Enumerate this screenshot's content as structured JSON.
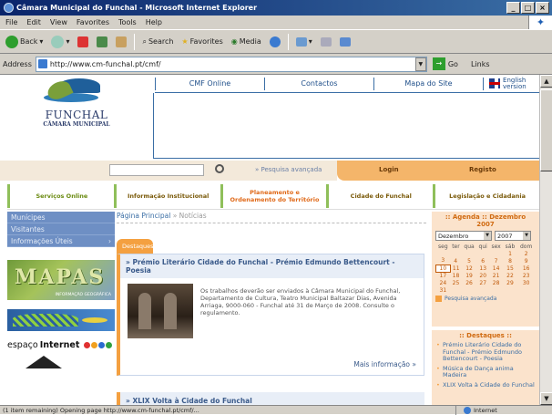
{
  "window": {
    "title": "Câmara Municipal do Funchal - Microsoft Internet Explorer",
    "controls": [
      "_",
      "□",
      "×"
    ]
  },
  "menu": [
    "File",
    "Edit",
    "View",
    "Favorites",
    "Tools",
    "Help"
  ],
  "toolbar": {
    "back": "Back",
    "search": "Search",
    "favorites": "Favorites",
    "media": "Media"
  },
  "address": {
    "label": "Address",
    "url": "http://www.cm-funchal.pt/cmf/",
    "go": "Go",
    "links": "Links"
  },
  "site": {
    "logo": {
      "name": "FUNCHAL",
      "sub": "CÂMARA MUNICIPAL"
    },
    "topnav": [
      "CMF Online",
      "Contactos",
      "Mapa do Site"
    ],
    "english": "English version",
    "search": {
      "advanced": "» Pesquisa avançada"
    },
    "login": "Login",
    "register": "Registo",
    "mainmenu": [
      "Serviços Online",
      "Informação Institucional",
      "Planeamento e Ordenamento do Território",
      "Cidade do Funchal",
      "Legislação e Cidadania"
    ],
    "leftnav": [
      "Munícipes",
      "Visitantes",
      "Informações Úteis"
    ],
    "mapas": "MAPAS",
    "mapas_sub": "INFORMAÇÃO GEOGRÁFICA",
    "espaco": {
      "a": "espaço",
      "b": "Internet"
    },
    "breadcrumb": {
      "home": "Página Principal",
      "current": " » Notícias"
    },
    "destaques_tab": "Destaques",
    "news1": {
      "title": "» Prémio Literário Cidade do Funchal - Prémio Edmundo Bettencourt - Poesia",
      "body": "Os trabalhos deverão ser enviados à Câmara Municipal do Funchal, Departamento de Cultura, Teatro Municipal Baltazar Dias, Avenida Arriaga, 9000-060 - Funchal até 31 de Março de 2008. Consulte o regulamento.",
      "more": "Mais informação »"
    },
    "news2": {
      "title": "» XLIX Volta à Cidade do Funchal"
    },
    "agenda": {
      "title": ":: Agenda :: Dezembro 2007",
      "month": "Dezembro",
      "year": "2007",
      "weekdays": [
        "seg",
        "ter",
        "qua",
        "qui",
        "sex",
        "sáb",
        "dom"
      ],
      "weeks": [
        [
          "",
          "",
          "",
          "",
          "",
          "1",
          "2"
        ],
        [
          "3",
          "4",
          "5",
          "6",
          "7",
          "8",
          "9"
        ],
        [
          "10",
          "11",
          "12",
          "13",
          "14",
          "15",
          "16"
        ],
        [
          "17",
          "18",
          "19",
          "20",
          "21",
          "22",
          "23"
        ],
        [
          "24",
          "25",
          "26",
          "27",
          "28",
          "29",
          "30"
        ],
        [
          "31",
          "",
          "",
          "",
          "",
          "",
          ""
        ]
      ],
      "highlight": "10",
      "advanced": "Pesquisa avançada"
    },
    "destaques_right": {
      "title": ":: Destaques ::",
      "items": [
        "Prémio Literário Cidade do Funchal - Prémio Edmundo Bettencourt - Poesia",
        "Música de Dança anima Madeira",
        "XLIX Volta à Cidade do Funchal"
      ]
    }
  },
  "status": {
    "text": "(1 item remaining) Opening page http://www.cm-funchal.pt/cmf/...",
    "zone": "Internet"
  },
  "colors": {
    "accent_orange": "#f4a040",
    "nav_blue": "#6e8fc4",
    "title_blue": "#0a246a"
  }
}
